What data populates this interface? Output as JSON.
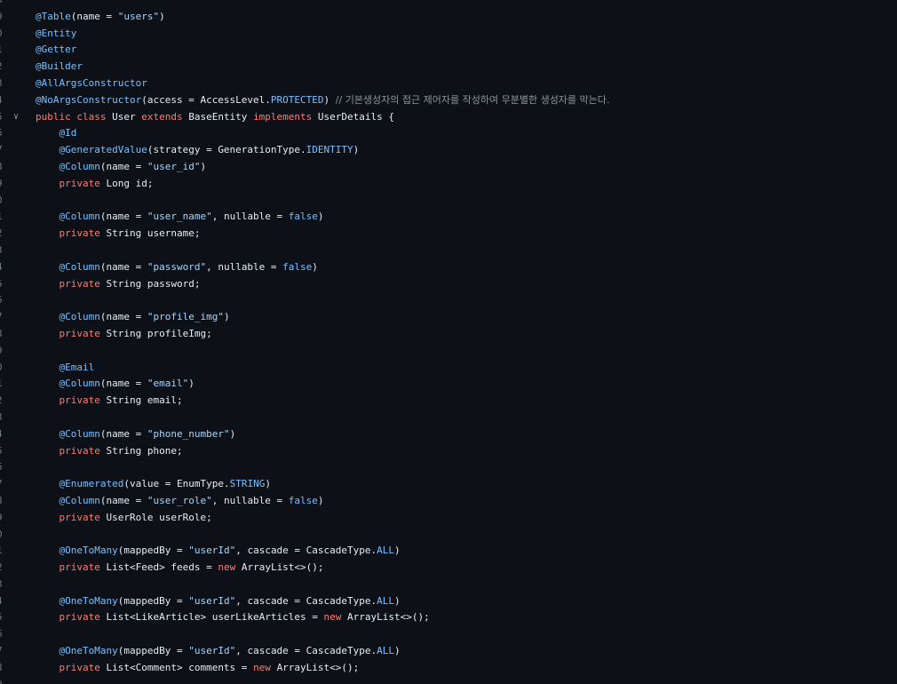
{
  "editor": {
    "line_numbers": [
      "8",
      "9",
      "0",
      "1",
      "2",
      "3",
      "4",
      "5",
      "6",
      "7",
      "8",
      "9",
      "0",
      "1",
      "2",
      "3",
      "4",
      "5",
      "6",
      "7",
      "8",
      "9",
      "0",
      "1",
      "2",
      "3",
      "4",
      "5",
      "6",
      "7",
      "8",
      "9",
      "0",
      "1",
      "2",
      "3",
      "4",
      "5",
      "6",
      "7",
      "8",
      "9"
    ],
    "fold_marker": "∨",
    "lines": [
      [],
      [
        {
          "t": "ann",
          "v": "@Table"
        },
        {
          "t": "plain",
          "v": "(name = "
        },
        {
          "t": "str",
          "v": "\"users\""
        },
        {
          "t": "plain",
          "v": ")"
        }
      ],
      [
        {
          "t": "ann",
          "v": "@Entity"
        }
      ],
      [
        {
          "t": "ann",
          "v": "@Getter"
        }
      ],
      [
        {
          "t": "ann",
          "v": "@Builder"
        }
      ],
      [
        {
          "t": "ann",
          "v": "@AllArgsConstructor"
        }
      ],
      [
        {
          "t": "ann",
          "v": "@NoArgsConstructor"
        },
        {
          "t": "plain",
          "v": "(access = AccessLevel."
        },
        {
          "t": "const",
          "v": "PROTECTED"
        },
        {
          "t": "plain",
          "v": ") "
        },
        {
          "t": "cmt",
          "v": "// 기본생성자의 접근 제어자를 작성하여 무분별한 생성자를 막는다."
        }
      ],
      [
        {
          "t": "kw",
          "v": "public class "
        },
        {
          "t": "plain",
          "v": "User "
        },
        {
          "t": "kw",
          "v": "extends "
        },
        {
          "t": "plain",
          "v": "BaseEntity "
        },
        {
          "t": "kw",
          "v": "implements "
        },
        {
          "t": "plain",
          "v": "UserDetails {"
        }
      ],
      [
        {
          "t": "plain",
          "v": "    "
        },
        {
          "t": "ann",
          "v": "@Id"
        }
      ],
      [
        {
          "t": "plain",
          "v": "    "
        },
        {
          "t": "ann",
          "v": "@GeneratedValue"
        },
        {
          "t": "plain",
          "v": "(strategy = GenerationType."
        },
        {
          "t": "const",
          "v": "IDENTITY"
        },
        {
          "t": "plain",
          "v": ")"
        }
      ],
      [
        {
          "t": "plain",
          "v": "    "
        },
        {
          "t": "ann",
          "v": "@Column"
        },
        {
          "t": "plain",
          "v": "(name = "
        },
        {
          "t": "str",
          "v": "\"user_id\""
        },
        {
          "t": "plain",
          "v": ")"
        }
      ],
      [
        {
          "t": "plain",
          "v": "    "
        },
        {
          "t": "kw",
          "v": "private "
        },
        {
          "t": "plain",
          "v": "Long id;"
        }
      ],
      [],
      [
        {
          "t": "plain",
          "v": "    "
        },
        {
          "t": "ann",
          "v": "@Column"
        },
        {
          "t": "plain",
          "v": "(name = "
        },
        {
          "t": "str",
          "v": "\"user_name\""
        },
        {
          "t": "plain",
          "v": ", nullable = "
        },
        {
          "t": "const",
          "v": "false"
        },
        {
          "t": "plain",
          "v": ")"
        }
      ],
      [
        {
          "t": "plain",
          "v": "    "
        },
        {
          "t": "kw",
          "v": "private "
        },
        {
          "t": "plain",
          "v": "String username;"
        }
      ],
      [],
      [
        {
          "t": "plain",
          "v": "    "
        },
        {
          "t": "ann",
          "v": "@Column"
        },
        {
          "t": "plain",
          "v": "(name = "
        },
        {
          "t": "str",
          "v": "\"password\""
        },
        {
          "t": "plain",
          "v": ", nullable = "
        },
        {
          "t": "const",
          "v": "false"
        },
        {
          "t": "plain",
          "v": ")"
        }
      ],
      [
        {
          "t": "plain",
          "v": "    "
        },
        {
          "t": "kw",
          "v": "private "
        },
        {
          "t": "plain",
          "v": "String password;"
        }
      ],
      [],
      [
        {
          "t": "plain",
          "v": "    "
        },
        {
          "t": "ann",
          "v": "@Column"
        },
        {
          "t": "plain",
          "v": "(name = "
        },
        {
          "t": "str",
          "v": "\"profile_img\""
        },
        {
          "t": "plain",
          "v": ")"
        }
      ],
      [
        {
          "t": "plain",
          "v": "    "
        },
        {
          "t": "kw",
          "v": "private "
        },
        {
          "t": "plain",
          "v": "String profileImg;"
        }
      ],
      [],
      [
        {
          "t": "plain",
          "v": "    "
        },
        {
          "t": "ann",
          "v": "@Email"
        }
      ],
      [
        {
          "t": "plain",
          "v": "    "
        },
        {
          "t": "ann",
          "v": "@Column"
        },
        {
          "t": "plain",
          "v": "(name = "
        },
        {
          "t": "str",
          "v": "\"email\""
        },
        {
          "t": "plain",
          "v": ")"
        }
      ],
      [
        {
          "t": "plain",
          "v": "    "
        },
        {
          "t": "kw",
          "v": "private "
        },
        {
          "t": "plain",
          "v": "String email;"
        }
      ],
      [],
      [
        {
          "t": "plain",
          "v": "    "
        },
        {
          "t": "ann",
          "v": "@Column"
        },
        {
          "t": "plain",
          "v": "(name = "
        },
        {
          "t": "str",
          "v": "\"phone_number\""
        },
        {
          "t": "plain",
          "v": ")"
        }
      ],
      [
        {
          "t": "plain",
          "v": "    "
        },
        {
          "t": "kw",
          "v": "private "
        },
        {
          "t": "plain",
          "v": "String phone;"
        }
      ],
      [],
      [
        {
          "t": "plain",
          "v": "    "
        },
        {
          "t": "ann",
          "v": "@Enumerated"
        },
        {
          "t": "plain",
          "v": "(value = EnumType."
        },
        {
          "t": "const",
          "v": "STRING"
        },
        {
          "t": "plain",
          "v": ")"
        }
      ],
      [
        {
          "t": "plain",
          "v": "    "
        },
        {
          "t": "ann",
          "v": "@Column"
        },
        {
          "t": "plain",
          "v": "(name = "
        },
        {
          "t": "str",
          "v": "\"user_role\""
        },
        {
          "t": "plain",
          "v": ", nullable = "
        },
        {
          "t": "const",
          "v": "false"
        },
        {
          "t": "plain",
          "v": ")"
        }
      ],
      [
        {
          "t": "plain",
          "v": "    "
        },
        {
          "t": "kw",
          "v": "private "
        },
        {
          "t": "plain",
          "v": "UserRole userRole;"
        }
      ],
      [],
      [
        {
          "t": "plain",
          "v": "    "
        },
        {
          "t": "ann",
          "v": "@OneToMany"
        },
        {
          "t": "plain",
          "v": "(mappedBy = "
        },
        {
          "t": "str",
          "v": "\"userId\""
        },
        {
          "t": "plain",
          "v": ", cascade = CascadeType."
        },
        {
          "t": "const",
          "v": "ALL"
        },
        {
          "t": "plain",
          "v": ")"
        }
      ],
      [
        {
          "t": "plain",
          "v": "    "
        },
        {
          "t": "kw",
          "v": "private "
        },
        {
          "t": "plain",
          "v": "List<Feed> feeds = "
        },
        {
          "t": "kw",
          "v": "new "
        },
        {
          "t": "plain",
          "v": "ArrayList<>();"
        }
      ],
      [],
      [
        {
          "t": "plain",
          "v": "    "
        },
        {
          "t": "ann",
          "v": "@OneToMany"
        },
        {
          "t": "plain",
          "v": "(mappedBy = "
        },
        {
          "t": "str",
          "v": "\"userId\""
        },
        {
          "t": "plain",
          "v": ", cascade = CascadeType."
        },
        {
          "t": "const",
          "v": "ALL"
        },
        {
          "t": "plain",
          "v": ")"
        }
      ],
      [
        {
          "t": "plain",
          "v": "    "
        },
        {
          "t": "kw",
          "v": "private "
        },
        {
          "t": "plain",
          "v": "List<LikeArticle> userLikeArticles = "
        },
        {
          "t": "kw",
          "v": "new "
        },
        {
          "t": "plain",
          "v": "ArrayList<>();"
        }
      ],
      [],
      [
        {
          "t": "plain",
          "v": "    "
        },
        {
          "t": "ann",
          "v": "@OneToMany"
        },
        {
          "t": "plain",
          "v": "(mappedBy = "
        },
        {
          "t": "str",
          "v": "\"userId\""
        },
        {
          "t": "plain",
          "v": ", cascade = CascadeType."
        },
        {
          "t": "const",
          "v": "ALL"
        },
        {
          "t": "plain",
          "v": ")"
        }
      ],
      [
        {
          "t": "plain",
          "v": "    "
        },
        {
          "t": "kw",
          "v": "private "
        },
        {
          "t": "plain",
          "v": "List<Comment> comments = "
        },
        {
          "t": "kw",
          "v": "new "
        },
        {
          "t": "plain",
          "v": "ArrayList<>();"
        }
      ],
      []
    ]
  },
  "colors": {
    "background": "#0d1117",
    "annotation": "#79c0ff",
    "keyword": "#ff7b72",
    "string": "#a5d6ff",
    "plain": "#e6edf3",
    "line_number": "#6e7681"
  }
}
